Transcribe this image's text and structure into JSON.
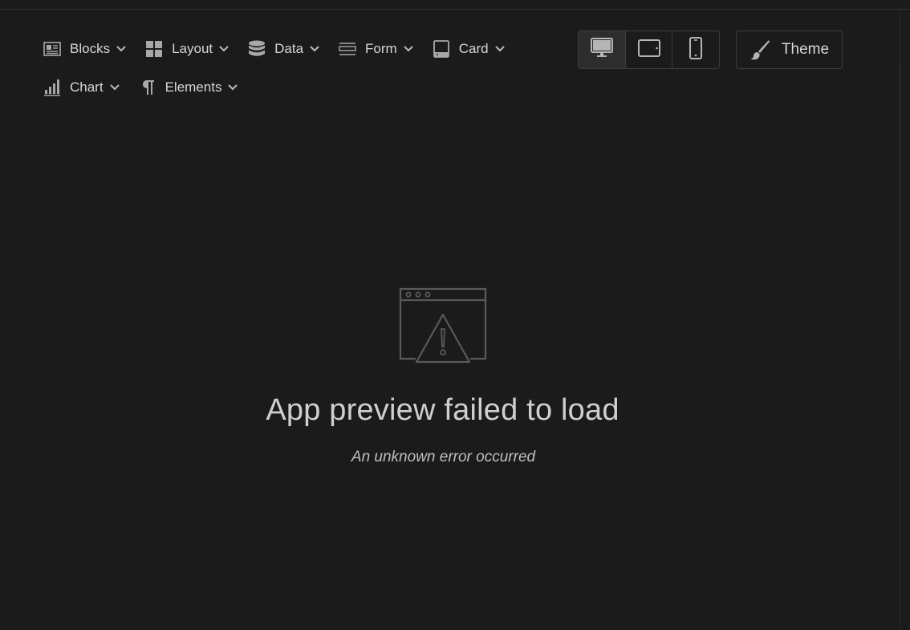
{
  "toolbar": {
    "row1": [
      {
        "label": "Blocks",
        "icon": "blocks-icon"
      },
      {
        "label": "Layout",
        "icon": "layout-grid-icon"
      },
      {
        "label": "Data",
        "icon": "database-icon"
      },
      {
        "label": "Form",
        "icon": "form-lines-icon"
      },
      {
        "label": "Card",
        "icon": "card-tablet-icon"
      }
    ],
    "row2": [
      {
        "label": "Chart",
        "icon": "bar-chart-icon"
      },
      {
        "label": "Elements",
        "icon": "pilcrow-icon"
      }
    ]
  },
  "devices": {
    "active": "desktop",
    "items": [
      "desktop",
      "tablet",
      "mobile"
    ]
  },
  "theme_button": {
    "label": "Theme",
    "icon": "paintbrush-icon"
  },
  "error": {
    "title": "App preview failed to load",
    "subtitle": "An unknown error occurred"
  },
  "colors": {
    "background": "#1b1b1b",
    "icon": "#a8a8a8",
    "border": "#3d3d3d",
    "illustration": "#5a5a5a"
  }
}
